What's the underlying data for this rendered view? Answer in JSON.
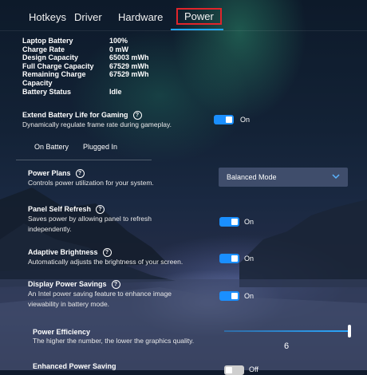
{
  "tabs": [
    "Hotkeys",
    "Driver",
    "Hardware",
    "Power"
  ],
  "battery_info": [
    {
      "key": "Laptop Battery",
      "value": "100%"
    },
    {
      "key": "Charge Rate",
      "value": "0 mW"
    },
    {
      "key": "Design Capacity",
      "value": "65003 mWh"
    },
    {
      "key": "Full Charge Capacity",
      "value": "67529 mWh"
    },
    {
      "key": "Remaining Charge Capacity",
      "value": "67529 mWh"
    },
    {
      "key": "Battery Status",
      "value": "Idle"
    }
  ],
  "extend_battery": {
    "title": "Extend Battery Life for Gaming",
    "desc": "Dynamically regulate frame rate during gameplay.",
    "state": "On"
  },
  "subtabs": [
    "On Battery",
    "Plugged In"
  ],
  "power_plans": {
    "title": "Power Plans",
    "desc": "Controls power utilization for your system.",
    "selected": "Balanced Mode"
  },
  "panel_self_refresh": {
    "title": "Panel Self Refresh",
    "desc1": "Saves power by allowing panel to refresh",
    "desc2": "independently.",
    "state": "On"
  },
  "adaptive_brightness": {
    "title": "Adaptive Brightness",
    "desc": "Automatically adjusts the brightness of your screen.",
    "state": "On"
  },
  "display_power_savings": {
    "title": "Display Power Savings",
    "desc1": "An Intel power saving feature to enhance image",
    "desc2": "viewability in battery mode.",
    "state": "On"
  },
  "power_efficiency": {
    "title": "Power Efficiency",
    "desc": "The higher the number, the lower the graphics quality.",
    "value": "6"
  },
  "enhanced_power_saving": {
    "title": "Enhanced Power Saving",
    "state": "Off"
  },
  "help_symbol": "?",
  "colors": {
    "accent": "#1a8fff",
    "highlight_box": "#e0252b"
  }
}
